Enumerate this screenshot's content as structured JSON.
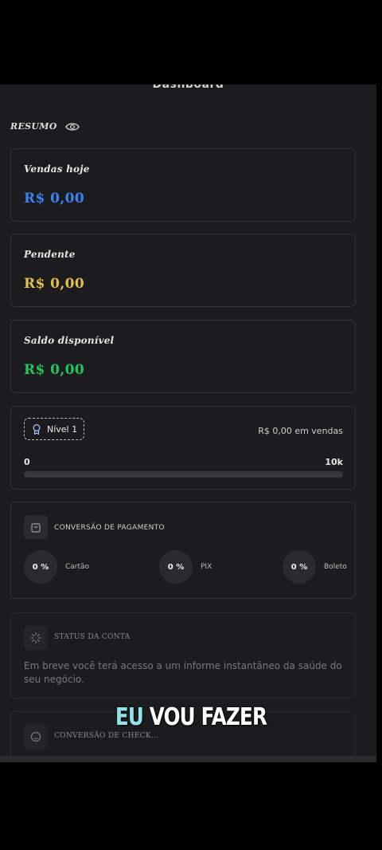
{
  "header": {
    "title": "Dashboard"
  },
  "summary": {
    "label": "RESUMO",
    "icon": "eye-icon"
  },
  "cards": [
    {
      "label": "Vendas hoje",
      "value": "R$ 0,00",
      "color": "#3b82f6"
    },
    {
      "label": "Pendente",
      "value": "R$ 0,00",
      "color": "#e2c14a"
    },
    {
      "label": "Saldo disponível",
      "value": "R$ 0,00",
      "color": "#22c55e"
    }
  ],
  "level": {
    "badge": "Nível 1",
    "sales_text": "R$ 0,00 em vendas",
    "min": "0",
    "max": "10k",
    "progress_fraction": 0
  },
  "conversion": {
    "title": "CONVERSÃO DE PAGAMENTO",
    "items": [
      {
        "percent": "0 %",
        "label": "Cartão"
      },
      {
        "percent": "0 %",
        "label": "PIX"
      },
      {
        "percent": "0 %",
        "label": "Boleto"
      }
    ]
  },
  "account_status": {
    "title": "STATUS DA CONTA",
    "text": "Em breve você terá acesso a um informe instantâneo da saúde do seu negócio."
  },
  "checkout_conversion": {
    "title": "CONVERSÃO DE CHECK..."
  },
  "caption": {
    "word1": "EU",
    "word2": "VOU FAZER"
  }
}
